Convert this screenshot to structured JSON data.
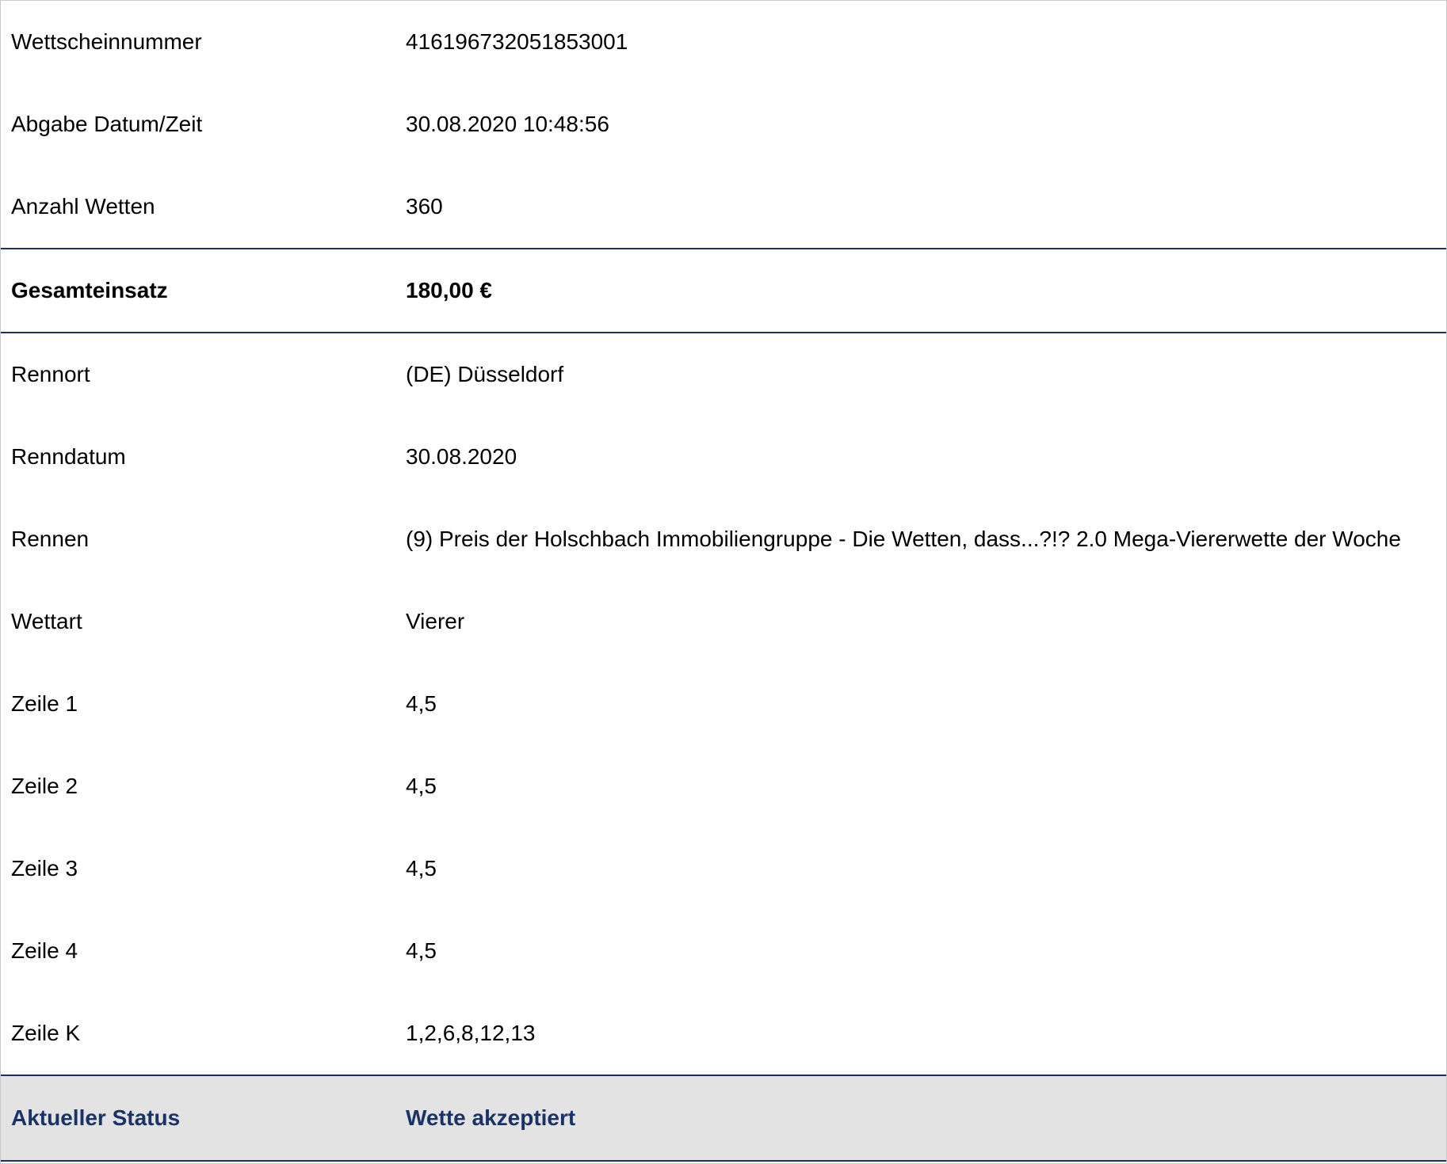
{
  "ticket_info": [
    {
      "label": "Wettscheinnummer",
      "value": "416196732051853001"
    },
    {
      "label": "Abgabe Datum/Zeit",
      "value": "30.08.2020 10:48:56"
    },
    {
      "label": "Anzahl Wetten",
      "value": "360"
    }
  ],
  "total": {
    "label": "Gesamteinsatz",
    "value": "180,00 €"
  },
  "race_info": [
    {
      "label": "Rennort",
      "value": "(DE) Düsseldorf"
    },
    {
      "label": "Renndatum",
      "value": "30.08.2020"
    },
    {
      "label": "Rennen",
      "value": "(9) Preis der Holschbach Immobiliengruppe - Die Wetten, dass...?!? 2.0 Mega-Viererwette der Woche"
    },
    {
      "label": "Wettart",
      "value": "Vierer"
    },
    {
      "label": "Zeile 1",
      "value": "4,5"
    },
    {
      "label": "Zeile 2",
      "value": "4,5"
    },
    {
      "label": "Zeile 3",
      "value": "4,5"
    },
    {
      "label": "Zeile 4",
      "value": "4,5"
    },
    {
      "label": "Zeile K",
      "value": "1,2,6,8,12,13"
    }
  ],
  "status": {
    "label": "Aktueller Status",
    "value": "Wette akzeptiert"
  },
  "colors": {
    "divider": "#1a2f66",
    "status_text": "#1a3366",
    "status_background": "#e3e3e3"
  }
}
